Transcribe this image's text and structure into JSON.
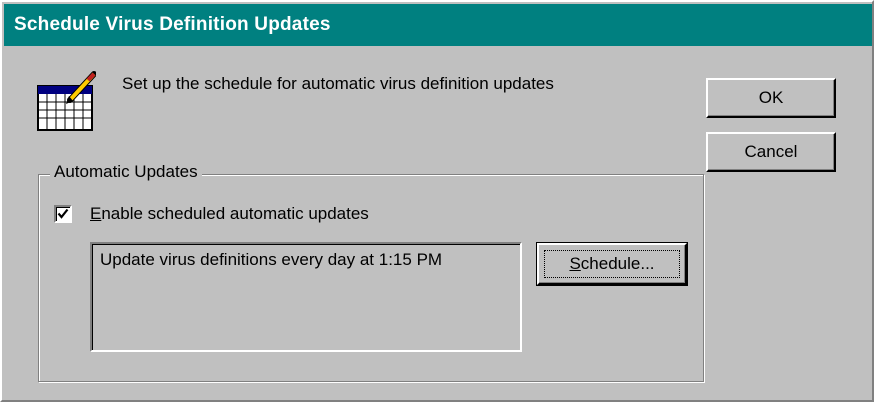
{
  "dialog": {
    "title": "Schedule Virus Definition Updates",
    "instruction": "Set up the schedule for automatic virus definition updates",
    "icon": "calendar-pencil-icon"
  },
  "buttons": {
    "ok_label": "OK",
    "cancel_label": "Cancel"
  },
  "automatic_updates": {
    "group_label": "Automatic Updates",
    "checkbox": {
      "checked": true,
      "label_accel": "E",
      "label_rest": "nable scheduled automatic updates"
    },
    "description": "Update virus definitions every day at 1:15 PM",
    "schedule_button": {
      "label_accel": "S",
      "label_rest": "chedule..."
    }
  },
  "colors": {
    "titlebar": "#008080",
    "face": "#c0c0c0"
  }
}
